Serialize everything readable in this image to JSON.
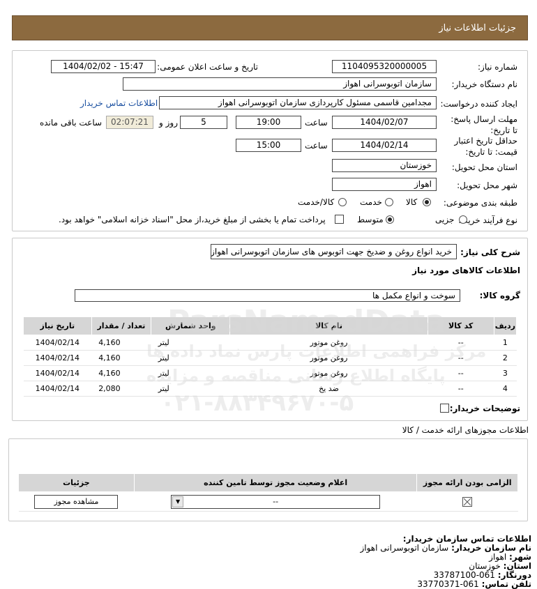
{
  "header": {
    "title": "جزئیات اطلاعات نیاز"
  },
  "form": {
    "need_number_label": "شماره نیاز:",
    "need_number": "1104095320000005",
    "announce_label": "تاریخ و ساعت اعلان عمومی:",
    "announce_value": "1404/02/02 - 15:47",
    "buyer_label": "نام دستگاه خریدار:",
    "buyer_value": "سازمان اتوبوسرانی اهواز",
    "creator_label": "ایجاد کننده درخواست:",
    "creator_value": "مجدامین قاسمی مسئول کارپردازی سازمان اتوبوسرانی اهواز",
    "contact_link": "اطلاعات تماس خریدار",
    "deadline_label": "مهلت ارسال پاسخ: تا تاریخ:",
    "deadline_date": "1404/02/07",
    "time_label": "ساعت",
    "deadline_time": "19:00",
    "days_value": "5",
    "days_label": "روز و",
    "remaining_time": "02:07:21",
    "remaining_label": "ساعت باقی مانده",
    "validity_label": "حداقل تاریخ اعتبار قیمت: تا تاریخ:",
    "validity_date": "1404/02/14",
    "validity_time": "15:00",
    "province_label": "استان محل تحویل:",
    "province_value": "خوزستان",
    "city_label": "شهر محل تحویل:",
    "city_value": "اهواز",
    "category_label": "طبقه بندی موضوعی:",
    "category_options": [
      "کالا",
      "خدمت",
      "کالا/خدمت"
    ],
    "purchase_label": "نوع فرآیند خرید :",
    "purchase_options": [
      "جزیی",
      "متوسط"
    ],
    "payment_note": "پرداخت تمام یا بخشی از مبلغ خرید،از محل \"اسناد خزانه اسلامی\" خواهد بود."
  },
  "summary": {
    "desc_label": "شرح کلی نیاز:",
    "desc_value": "خرید انواع روغن و ضدیخ جهت اتوبوس های سازمان اتوبوسرانی اهواز",
    "goods_title": "اطلاعات کالاهای مورد نیاز",
    "group_label": "گروه کالا:",
    "group_value": "سوخت  و انواع مکمل  ها",
    "columns": [
      "ردیف",
      "کد کالا",
      "نام کالا",
      "واحد شمارش",
      "تعداد / مقدار",
      "تاریخ نیاز"
    ],
    "rows": [
      {
        "n": "1",
        "code": "--",
        "name": "روغن موتور",
        "unit": "لیتر",
        "qty": "4,160",
        "date": "1404/02/14"
      },
      {
        "n": "2",
        "code": "--",
        "name": "روغن موتور",
        "unit": "لیتر",
        "qty": "4,160",
        "date": "1404/02/14"
      },
      {
        "n": "3",
        "code": "--",
        "name": "روغن موتور",
        "unit": "لیتر",
        "qty": "4,160",
        "date": "1404/02/14"
      },
      {
        "n": "4",
        "code": "--",
        "name": "ضد یخ",
        "unit": "لیتر",
        "qty": "2,080",
        "date": "1404/02/14"
      }
    ],
    "buyer_notes_label": "توضیحات خریدار:"
  },
  "permits": {
    "title": "اطلاعات مجوزهای ارائه خدمت / کالا",
    "columns": [
      "الزامی بودن ارائه مجوز",
      "اعلام وضعیت مجوز توسط تامین کننده",
      "جزئیات"
    ],
    "select_value": "--",
    "view_button": "مشاهده مجوز"
  },
  "contact": {
    "title": "اطلاعات تماس سازمان خریدار:",
    "org_label": "نام سازمان خریدار:",
    "org_value": "سازمان اتوبوسرانی اهواز",
    "city_label": "شهر:",
    "city_value": "اهواز",
    "province_label": "استان:",
    "province_value": "خوزستان",
    "fax_label": "دورنگار:",
    "fax_value": "061-33787100",
    "phone_label": "تلفن تماس:",
    "phone_value": "061-33770371"
  },
  "watermark": {
    "line1": "ParsNamadData",
    "line2": "مرکز فراهمی اطلاعات پارس نماد داده ها",
    "line3": "پایگاه اطلاع رسانی مناقصه و مزایده",
    "line4": "۰۲۱-۸۸۳۴۹۶۷۰-۵"
  }
}
